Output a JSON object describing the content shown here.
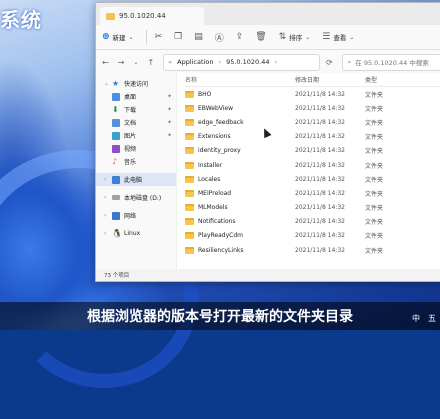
{
  "desktop": {
    "heading": "系统"
  },
  "window": {
    "tab_title": "95.0.1020.44",
    "toolbar": {
      "new_label": "新建",
      "sort_label": "排序",
      "view_label": "查看"
    },
    "address": {
      "segments": [
        "Application",
        "95.0.1020.44"
      ],
      "search_placeholder": "在 95.0.1020.44 中搜索"
    },
    "nav": {
      "quick_access": "快速访问",
      "items": [
        {
          "label": "桌面",
          "icon": "desktop-icon"
        },
        {
          "label": "下载",
          "icon": "download-icon"
        },
        {
          "label": "文档",
          "icon": "document-icon"
        },
        {
          "label": "图片",
          "icon": "picture-icon"
        },
        {
          "label": "视频",
          "icon": "video-icon"
        },
        {
          "label": "音乐",
          "icon": "music-icon"
        }
      ],
      "this_pc": "此电脑",
      "local_disk": "本地磁盘 (D:)",
      "network": "网络",
      "linux": "Linux"
    },
    "columns": {
      "name": "名称",
      "modified": "修改日期",
      "type": "类型"
    },
    "files": [
      {
        "name": "BHO",
        "date": "2021/11/8 14:32",
        "type": "文件夹"
      },
      {
        "name": "EBWebView",
        "date": "2021/11/8 14:32",
        "type": "文件夹"
      },
      {
        "name": "edge_feedback",
        "date": "2021/11/8 14:32",
        "type": "文件夹"
      },
      {
        "name": "Extensions",
        "date": "2021/11/8 14:32",
        "type": "文件夹"
      },
      {
        "name": "identity_proxy",
        "date": "2021/11/8 14:32",
        "type": "文件夹"
      },
      {
        "name": "Installer",
        "date": "2021/11/8 14:32",
        "type": "文件夹"
      },
      {
        "name": "Locales",
        "date": "2021/11/8 14:32",
        "type": "文件夹"
      },
      {
        "name": "MEIPreload",
        "date": "2021/11/8 14:32",
        "type": "文件夹"
      },
      {
        "name": "MLModels",
        "date": "2021/11/8 14:32",
        "type": "文件夹"
      },
      {
        "name": "Notifications",
        "date": "2021/11/8 14:32",
        "type": "文件夹"
      },
      {
        "name": "PlayReadyCdm",
        "date": "2021/11/8 14:32",
        "type": "文件夹"
      },
      {
        "name": "ResiliencyLinks",
        "date": "2021/11/8 14:32",
        "type": "文件夹"
      }
    ],
    "status": "73 个项目"
  },
  "caption": "根据浏览器的版本号打开最新的文件夹目录",
  "tray": {
    "ime": "中",
    "week": "五"
  }
}
